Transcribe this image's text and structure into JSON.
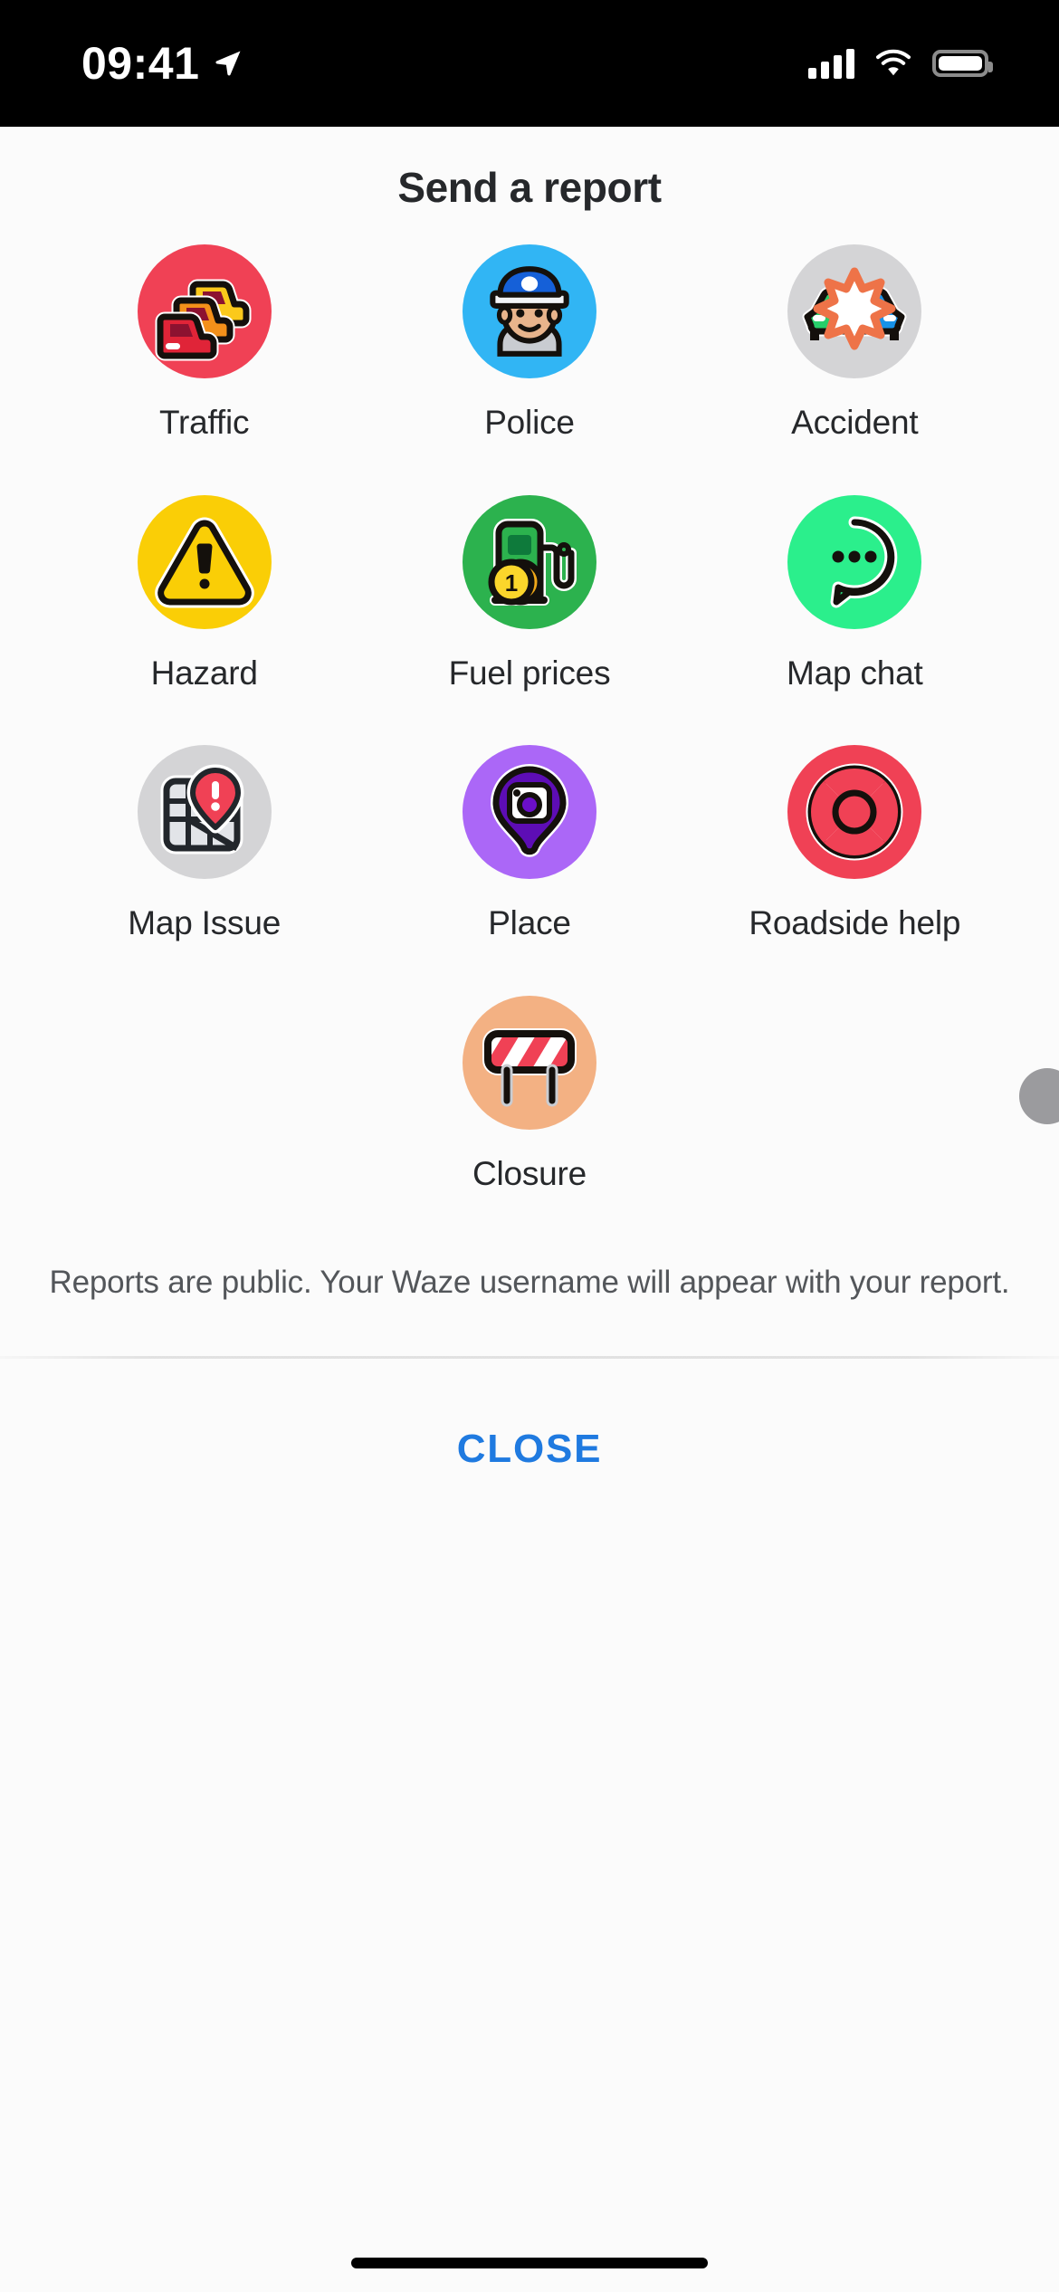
{
  "status_bar": {
    "time": "09:41",
    "location_icon": "location-arrow-icon",
    "cellular_icon": "cellular-signal-icon",
    "wifi_icon": "wifi-icon",
    "battery_icon": "battery-icon"
  },
  "header": {
    "title": "Send a report"
  },
  "report_options": [
    {
      "id": "traffic",
      "label": "Traffic",
      "icon": "traffic-jam-icon",
      "circle_color": "#F04155"
    },
    {
      "id": "police",
      "label": "Police",
      "icon": "police-officer-icon",
      "circle_color": "#31B5F4"
    },
    {
      "id": "accident",
      "label": "Accident",
      "icon": "car-crash-icon",
      "circle_color": "#D4D4D6"
    },
    {
      "id": "hazard",
      "label": "Hazard",
      "icon": "warning-triangle-icon",
      "circle_color": "#FACE06"
    },
    {
      "id": "fuel-prices",
      "label": "Fuel prices",
      "icon": "fuel-pump-icon",
      "circle_color": "#2CB24E"
    },
    {
      "id": "map-chat",
      "label": "Map chat",
      "icon": "chat-bubble-icon",
      "circle_color": "#2BEF8C"
    },
    {
      "id": "map-issue",
      "label": "Map Issue",
      "icon": "map-pin-alert-icon",
      "circle_color": "#D4D4D6"
    },
    {
      "id": "place",
      "label": "Place",
      "icon": "place-camera-pin-icon",
      "circle_color": "#AB67F7"
    },
    {
      "id": "roadside-help",
      "label": "Roadside help",
      "icon": "life-ring-icon",
      "circle_color": "#F04155"
    },
    {
      "id": "closure",
      "label": "Closure",
      "icon": "road-barricade-icon",
      "circle_color": "#F3B183"
    }
  ],
  "footer": {
    "disclaimer": "Reports are public. Your Waze username will appear with your report.",
    "close_label": "CLOSE",
    "close_color": "#1f7ae0"
  }
}
